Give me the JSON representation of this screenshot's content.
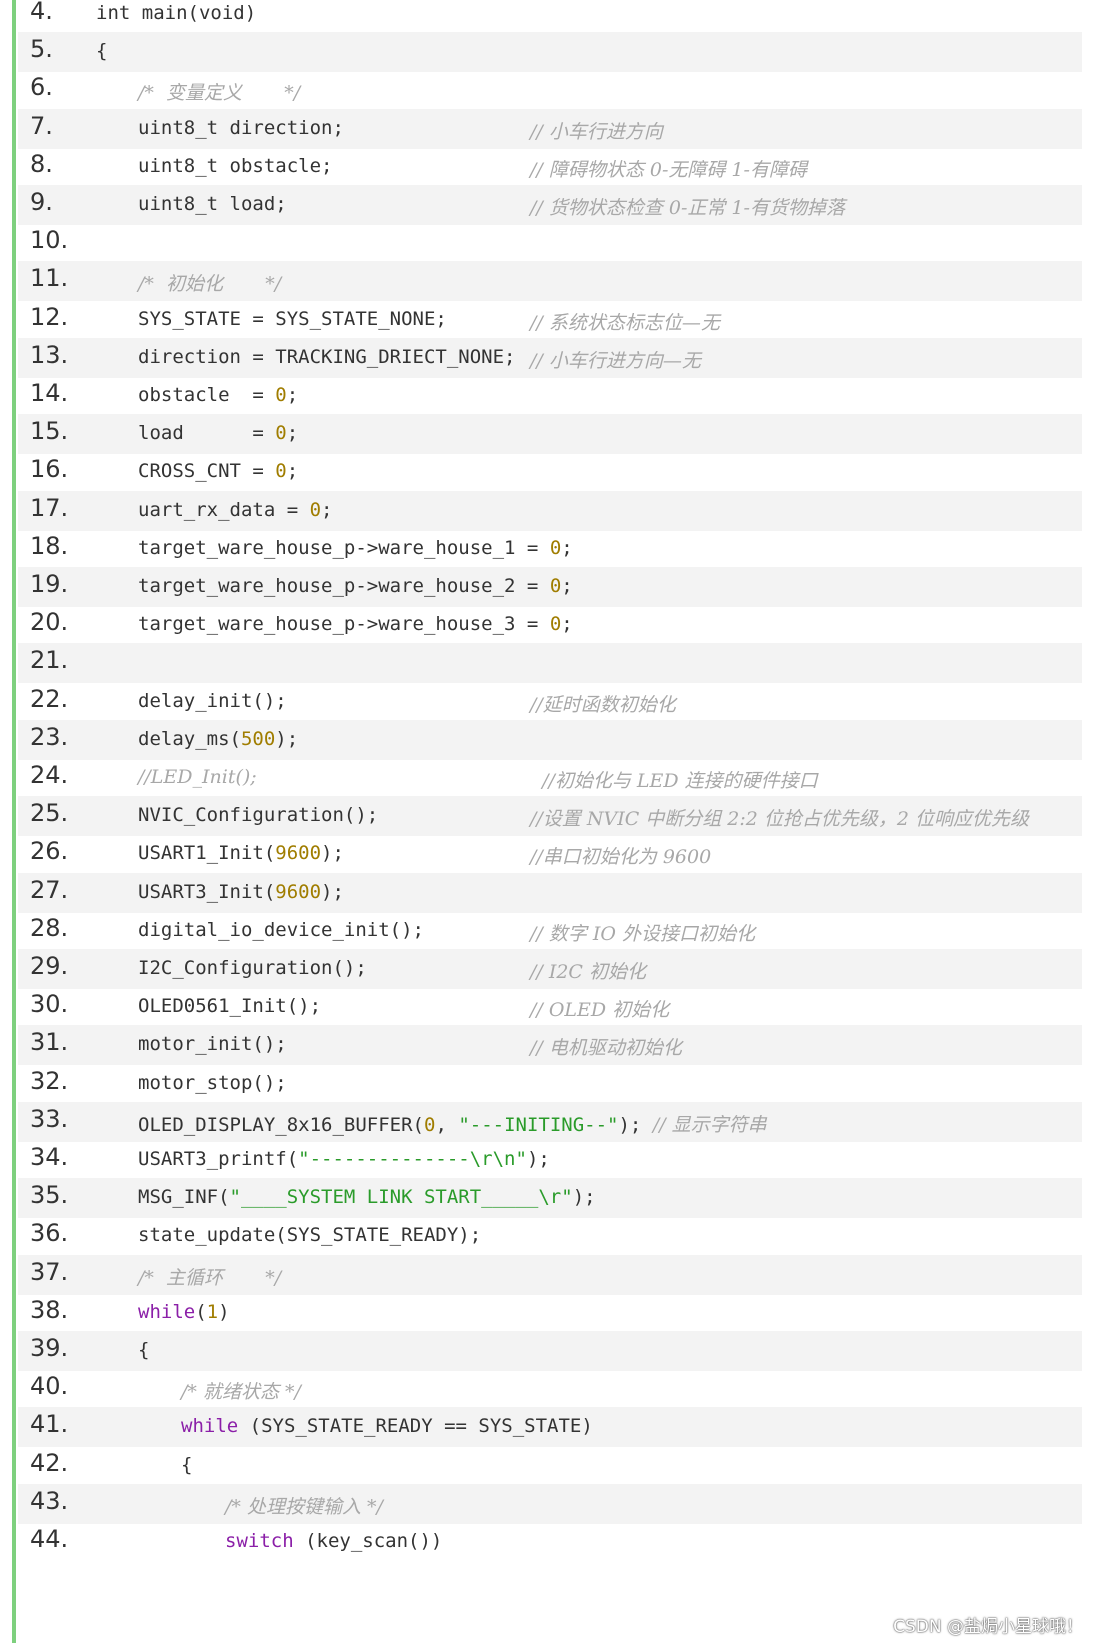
{
  "lines": [
    {
      "n": "4.",
      "indent": 0,
      "parts": [
        {
          "t": "int main(void)",
          "c": "code"
        }
      ],
      "comment": ""
    },
    {
      "n": "5.",
      "indent": 0,
      "parts": [
        {
          "t": "{",
          "c": "code"
        }
      ],
      "comment": ""
    },
    {
      "n": "6.",
      "indent": 1,
      "parts": [
        {
          "t": "/*  变量定义       */",
          "c": "cmt"
        }
      ],
      "comment": ""
    },
    {
      "n": "7.",
      "indent": 1,
      "parts": [
        {
          "t": "uint8_t direction;",
          "c": "code"
        }
      ],
      "comment": "// 小车行进方向"
    },
    {
      "n": "8.",
      "indent": 1,
      "parts": [
        {
          "t": "uint8_t obstacle;",
          "c": "code"
        }
      ],
      "comment": "// 障碍物状态 0-无障碍 1-有障碍"
    },
    {
      "n": "9.",
      "indent": 1,
      "parts": [
        {
          "t": "uint8_t load;",
          "c": "code"
        }
      ],
      "comment": "// 货物状态检查 0-正常 1-有货物掉落"
    },
    {
      "n": "10.",
      "indent": 0,
      "parts": [],
      "comment": ""
    },
    {
      "n": "11.",
      "indent": 1,
      "parts": [
        {
          "t": "/*  初始化       */",
          "c": "cmt"
        }
      ],
      "comment": ""
    },
    {
      "n": "12.",
      "indent": 1,
      "parts": [
        {
          "t": "SYS_STATE = SYS_STATE_NONE;",
          "c": "code"
        }
      ],
      "comment": "// 系统状态标志位—无"
    },
    {
      "n": "13.",
      "indent": 1,
      "parts": [
        {
          "t": "direction = TRACKING_DRIECT_NONE;",
          "c": "code"
        }
      ],
      "comment": "// 小车行进方向—无"
    },
    {
      "n": "14.",
      "indent": 1,
      "parts": [
        {
          "t": "obstacle  = ",
          "c": "code"
        },
        {
          "t": "0",
          "c": "num"
        },
        {
          "t": ";",
          "c": "code"
        }
      ],
      "comment": ""
    },
    {
      "n": "15.",
      "indent": 1,
      "parts": [
        {
          "t": "load      = ",
          "c": "code"
        },
        {
          "t": "0",
          "c": "num"
        },
        {
          "t": ";",
          "c": "code"
        }
      ],
      "comment": ""
    },
    {
      "n": "16.",
      "indent": 1,
      "parts": [
        {
          "t": "CROSS_CNT = ",
          "c": "code"
        },
        {
          "t": "0",
          "c": "num"
        },
        {
          "t": ";",
          "c": "code"
        }
      ],
      "comment": ""
    },
    {
      "n": "17.",
      "indent": 1,
      "parts": [
        {
          "t": "uart_rx_data = ",
          "c": "code"
        },
        {
          "t": "0",
          "c": "num"
        },
        {
          "t": ";",
          "c": "code"
        }
      ],
      "comment": ""
    },
    {
      "n": "18.",
      "indent": 1,
      "parts": [
        {
          "t": "target_ware_house_p->ware_house_1 = ",
          "c": "code"
        },
        {
          "t": "0",
          "c": "num"
        },
        {
          "t": ";",
          "c": "code"
        }
      ],
      "comment": ""
    },
    {
      "n": "19.",
      "indent": 1,
      "parts": [
        {
          "t": "target_ware_house_p->ware_house_2 = ",
          "c": "code"
        },
        {
          "t": "0",
          "c": "num"
        },
        {
          "t": ";",
          "c": "code"
        }
      ],
      "comment": ""
    },
    {
      "n": "20.",
      "indent": 1,
      "parts": [
        {
          "t": "target_ware_house_p->ware_house_3 = ",
          "c": "code"
        },
        {
          "t": "0",
          "c": "num"
        },
        {
          "t": ";",
          "c": "code"
        }
      ],
      "comment": ""
    },
    {
      "n": "21.",
      "indent": 0,
      "parts": [],
      "comment": ""
    },
    {
      "n": "22.",
      "indent": 1,
      "parts": [
        {
          "t": "delay_init();",
          "c": "code"
        }
      ],
      "comment": "//延时函数初始化"
    },
    {
      "n": "23.",
      "indent": 1,
      "parts": [
        {
          "t": "delay_ms(",
          "c": "code"
        },
        {
          "t": "500",
          "c": "num"
        },
        {
          "t": ");",
          "c": "code"
        }
      ],
      "comment": ""
    },
    {
      "n": "24.",
      "indent": 1,
      "parts": [
        {
          "t": "//LED_Init();",
          "c": "cmt"
        }
      ],
      "comment": "  //初始化与 LED 连接的硬件接口"
    },
    {
      "n": "25.",
      "indent": 1,
      "parts": [
        {
          "t": "NVIC_Configuration();",
          "c": "code"
        }
      ],
      "comment": "//设置 NVIC 中断分组 2:2 位抢占优先级，2 位响应优先级"
    },
    {
      "n": "26.",
      "indent": 1,
      "parts": [
        {
          "t": "USART1_Init(",
          "c": "code"
        },
        {
          "t": "9600",
          "c": "num"
        },
        {
          "t": ");",
          "c": "code"
        }
      ],
      "comment": "//串口初始化为 9600"
    },
    {
      "n": "27.",
      "indent": 1,
      "parts": [
        {
          "t": "USART3_Init(",
          "c": "code"
        },
        {
          "t": "9600",
          "c": "num"
        },
        {
          "t": ");",
          "c": "code"
        }
      ],
      "comment": ""
    },
    {
      "n": "28.",
      "indent": 1,
      "parts": [
        {
          "t": "digital_io_device_init();",
          "c": "code"
        }
      ],
      "comment": "// 数字 IO 外设接口初始化"
    },
    {
      "n": "29.",
      "indent": 1,
      "parts": [
        {
          "t": "I2C_Configuration();",
          "c": "code"
        }
      ],
      "comment": "// I2C 初始化"
    },
    {
      "n": "30.",
      "indent": 1,
      "parts": [
        {
          "t": "OLED0561_Init();",
          "c": "code"
        }
      ],
      "comment": "// OLED 初始化"
    },
    {
      "n": "31.",
      "indent": 1,
      "parts": [
        {
          "t": "motor_init();",
          "c": "code"
        }
      ],
      "comment": "// 电机驱动初始化"
    },
    {
      "n": "32.",
      "indent": 1,
      "parts": [
        {
          "t": "motor_stop();",
          "c": "code"
        }
      ],
      "comment": ""
    },
    {
      "n": "33.",
      "indent": 1,
      "parts": [
        {
          "t": "OLED_DISPLAY_8x16_BUFFER(",
          "c": "code"
        },
        {
          "t": "0",
          "c": "num"
        },
        {
          "t": ", ",
          "c": "code"
        },
        {
          "t": "\"---INITING--\"",
          "c": "str"
        },
        {
          "t": "); ",
          "c": "code"
        },
        {
          "t": "// 显示字符串",
          "c": "cmt"
        }
      ],
      "comment": ""
    },
    {
      "n": "34.",
      "indent": 1,
      "parts": [
        {
          "t": "USART3_printf(",
          "c": "code"
        },
        {
          "t": "\"--------------\\r\\n\"",
          "c": "str"
        },
        {
          "t": ");",
          "c": "code"
        }
      ],
      "comment": ""
    },
    {
      "n": "35.",
      "indent": 1,
      "parts": [
        {
          "t": "MSG_INF(",
          "c": "code"
        },
        {
          "t": "\"____SYSTEM LINK START_____\\r\"",
          "c": "str"
        },
        {
          "t": ");",
          "c": "code"
        }
      ],
      "comment": ""
    },
    {
      "n": "36.",
      "indent": 1,
      "parts": [
        {
          "t": "state_update(SYS_STATE_READY);",
          "c": "code"
        }
      ],
      "comment": ""
    },
    {
      "n": "37.",
      "indent": 1,
      "parts": [
        {
          "t": "/*  主循环       */",
          "c": "cmt"
        }
      ],
      "comment": ""
    },
    {
      "n": "38.",
      "indent": 1,
      "parts": [
        {
          "t": "while",
          "c": "kw"
        },
        {
          "t": "(",
          "c": "code"
        },
        {
          "t": "1",
          "c": "num"
        },
        {
          "t": ")",
          "c": "code"
        }
      ],
      "comment": ""
    },
    {
      "n": "39.",
      "indent": 1,
      "parts": [
        {
          "t": "{",
          "c": "code"
        }
      ],
      "comment": ""
    },
    {
      "n": "40.",
      "indent": 2,
      "parts": [
        {
          "t": "/* 就绪状态 */",
          "c": "cmt"
        }
      ],
      "comment": ""
    },
    {
      "n": "41.",
      "indent": 2,
      "parts": [
        {
          "t": "while",
          "c": "kw"
        },
        {
          "t": " (SYS_STATE_READY == SYS_STATE)",
          "c": "code"
        }
      ],
      "comment": ""
    },
    {
      "n": "42.",
      "indent": 2,
      "parts": [
        {
          "t": "{",
          "c": "code"
        }
      ],
      "comment": ""
    },
    {
      "n": "43.",
      "indent": 3,
      "parts": [
        {
          "t": "/* 处理按键输入 */",
          "c": "cmt"
        }
      ],
      "comment": ""
    },
    {
      "n": "44.",
      "indent": 3,
      "parts": [
        {
          "t": "switch",
          "c": "kw"
        },
        {
          "t": " (key_scan())",
          "c": "code"
        }
      ],
      "comment": ""
    }
  ],
  "watermark": "CSDN @盐焗小星球哦！",
  "colors": {
    "code": "#333333",
    "comment": "#a8a8a8",
    "number": "#a07d00",
    "string": "#2a9b2a",
    "keyword": "#8b1fa8",
    "gutter": "#7ed07e",
    "stripe": "#f3f3f3"
  }
}
